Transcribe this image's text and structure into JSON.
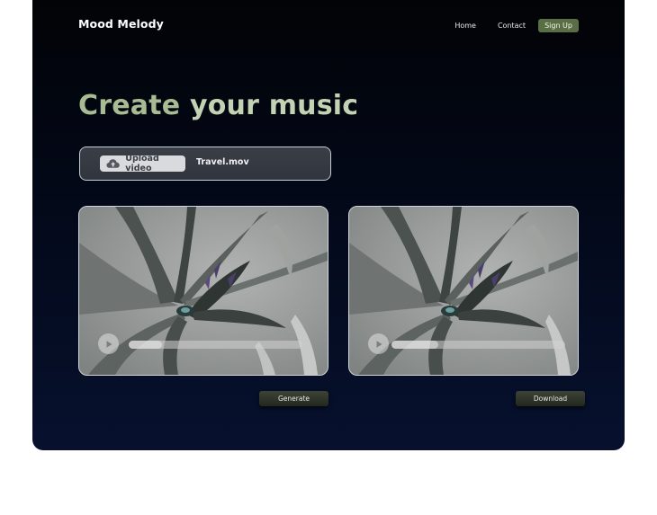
{
  "header": {
    "brand": "Mood Melody",
    "nav": {
      "home": "Home",
      "contact": "Contact",
      "signup": "Sign Up"
    }
  },
  "hero": {
    "title_part1": "Create",
    "title_part2": " your music"
  },
  "upload": {
    "button_label": "Upload video",
    "file_name": "Travel.mov"
  },
  "players": [
    {
      "progress": 0.19
    },
    {
      "progress": 0.27
    }
  ],
  "actions": {
    "generate": "Generate",
    "download": "Download"
  },
  "icons": {
    "upload": "cloud-upload-icon",
    "play": "play-icon"
  },
  "colors": {
    "accent": "#5a6e45",
    "hero_text": "#a8bb93",
    "background_top": "#020306",
    "background_bottom": "#07112e"
  }
}
